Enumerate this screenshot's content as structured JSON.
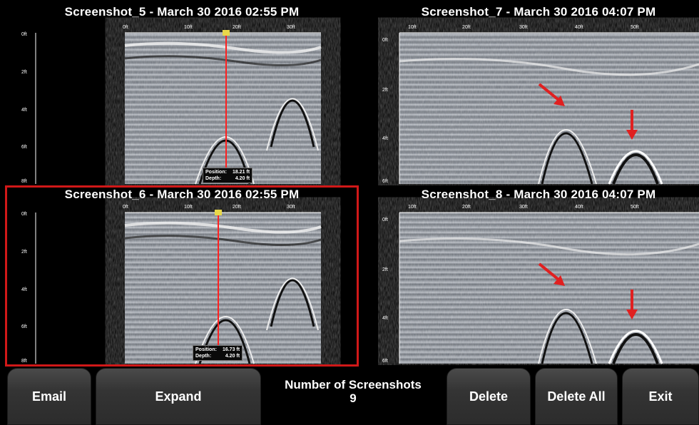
{
  "screenshots": [
    {
      "title": "Screenshot_5 - March 30 2016 02:55 PM",
      "x_ticks": [
        "0ft",
        "10ft",
        "20ft",
        "30ft"
      ],
      "y_ticks": [
        "0ft",
        "2ft",
        "4ft",
        "6ft",
        "8ft"
      ],
      "readout": {
        "position_label": "Position:",
        "position_value": "18.21 ft",
        "depth_label": "Depth:",
        "depth_value": "4.20 ft"
      }
    },
    {
      "title": "Screenshot_7 - March 30 2016 04:07 PM",
      "x_ticks": [
        "10ft",
        "20ft",
        "30ft",
        "40ft",
        "50ft"
      ],
      "y_ticks": [
        "0ft",
        "2ft",
        "4ft",
        "6ft"
      ]
    },
    {
      "title": "Screenshot_6 - March 30 2016 02:55 PM",
      "x_ticks": [
        "0ft",
        "10ft",
        "20ft",
        "30ft"
      ],
      "y_ticks": [
        "0ft",
        "2ft",
        "4ft",
        "6ft",
        "8ft"
      ],
      "readout": {
        "position_label": "Position:",
        "position_value": "16.73 ft",
        "depth_label": "Depth:",
        "depth_value": "4.20 ft"
      }
    },
    {
      "title": "Screenshot_8 - March 30 2016 04:07 PM",
      "x_ticks": [
        "10ft",
        "20ft",
        "30ft",
        "40ft",
        "50ft"
      ],
      "y_ticks": [
        "0ft",
        "2ft",
        "4ft",
        "6ft"
      ]
    }
  ],
  "toolbar": {
    "email_label": "Email",
    "expand_label": "Expand",
    "count_label": "Number of Screenshots",
    "count_value": "9",
    "delete_label": "Delete",
    "delete_all_label": "Delete All",
    "exit_label": "Exit"
  },
  "colors": {
    "selection": "#d01818",
    "cursor": "#ff2020",
    "arrow": "#e02020",
    "scan_bg": "#8a9099"
  }
}
